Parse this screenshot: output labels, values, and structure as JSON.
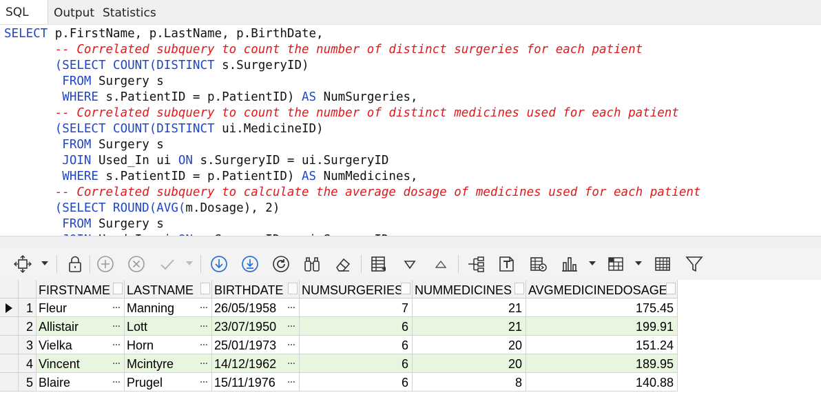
{
  "tabs": [
    {
      "label": "SQL",
      "active": true
    },
    {
      "label": "Output",
      "active": false
    },
    {
      "label": "Statistics",
      "active": false
    }
  ],
  "editor": {
    "language": "SQL",
    "lines": [
      [
        {
          "t": "kw",
          "v": "SELECT"
        },
        {
          "t": "tx",
          "v": " p.FirstName, p.LastName, p.BirthDate,"
        }
      ],
      [
        {
          "t": "cm",
          "v": "       -- Correlated subquery to count the number of distinct surgeries for each patient"
        }
      ],
      [
        {
          "t": "kw",
          "v": "       (SELECT COUNT(DISTINCT"
        },
        {
          "t": "tx",
          "v": " s.SurgeryID)"
        }
      ],
      [
        {
          "t": "kw",
          "v": "        FROM"
        },
        {
          "t": "tx",
          "v": " Surgery s"
        }
      ],
      [
        {
          "t": "kw",
          "v": "        WHERE"
        },
        {
          "t": "tx",
          "v": " s.PatientID = p.PatientID) "
        },
        {
          "t": "kw",
          "v": "AS"
        },
        {
          "t": "tx",
          "v": " NumSurgeries,"
        }
      ],
      [
        {
          "t": "cm",
          "v": "       -- Correlated subquery to count the number of distinct medicines used for each patient"
        }
      ],
      [
        {
          "t": "kw",
          "v": "       (SELECT COUNT(DISTINCT"
        },
        {
          "t": "tx",
          "v": " ui.MedicineID)"
        }
      ],
      [
        {
          "t": "kw",
          "v": "        FROM"
        },
        {
          "t": "tx",
          "v": " Surgery s"
        }
      ],
      [
        {
          "t": "kw",
          "v": "        JOIN"
        },
        {
          "t": "tx",
          "v": " Used_In ui "
        },
        {
          "t": "kw",
          "v": "ON"
        },
        {
          "t": "tx",
          "v": " s.SurgeryID = ui.SurgeryID"
        }
      ],
      [
        {
          "t": "kw",
          "v": "        WHERE"
        },
        {
          "t": "tx",
          "v": " s.PatientID = p.PatientID) "
        },
        {
          "t": "kw",
          "v": "AS"
        },
        {
          "t": "tx",
          "v": " NumMedicines,"
        }
      ],
      [
        {
          "t": "cm",
          "v": "       -- Correlated subquery to calculate the average dosage of medicines used for each patient"
        }
      ],
      [
        {
          "t": "kw",
          "v": "       (SELECT ROUND(AVG("
        },
        {
          "t": "tx",
          "v": "m.Dosage), 2)"
        }
      ],
      [
        {
          "t": "kw",
          "v": "        FROM"
        },
        {
          "t": "tx",
          "v": " Surgery s"
        }
      ],
      [
        {
          "t": "kw",
          "v": "        JOIN"
        },
        {
          "t": "tx",
          "v": " Used_In ui "
        },
        {
          "t": "kw",
          "v": "ON"
        },
        {
          "t": "tx",
          "v": " s.SurgeryID = ui.SurgeryID"
        }
      ]
    ]
  },
  "toolbar": {
    "buttons": [
      {
        "icon": "navigator-icon",
        "enabled": true,
        "dropdown": true
      },
      {
        "icon": "lock-icon",
        "enabled": true
      },
      {
        "icon": "add-record-icon",
        "enabled": false
      },
      {
        "icon": "delete-record-icon",
        "enabled": false
      },
      {
        "icon": "post-edit-icon",
        "enabled": false,
        "dropdown": true
      },
      {
        "icon": "fetch-next-icon",
        "enabled": true
      },
      {
        "icon": "fetch-last-icon",
        "enabled": true
      },
      {
        "icon": "refresh-icon",
        "enabled": true
      },
      {
        "icon": "search-records-icon",
        "enabled": true
      },
      {
        "icon": "clear-icon",
        "enabled": true
      },
      {
        "icon": "single-record-view-icon",
        "enabled": true
      },
      {
        "icon": "sort-descending-icon",
        "enabled": true
      },
      {
        "icon": "sort-ascending-icon",
        "enabled": true
      },
      {
        "icon": "tree-view-icon",
        "enabled": true
      },
      {
        "icon": "export-text-icon",
        "enabled": true
      },
      {
        "icon": "export-grid-icon",
        "enabled": true
      },
      {
        "icon": "chart-icon",
        "enabled": true,
        "dropdown": true
      },
      {
        "icon": "pivot-icon",
        "enabled": true,
        "dropdown": true
      },
      {
        "icon": "grid-icon",
        "enabled": true
      },
      {
        "icon": "filter-icon",
        "enabled": true
      }
    ]
  },
  "grid": {
    "columns": [
      "FIRSTNAME",
      "LASTNAME",
      "BIRTHDATE",
      "NUMSURGERIES",
      "NUMMEDICINES",
      "AVGMEDICINEDOSAGE"
    ],
    "ellipsis": "…",
    "rows": [
      {
        "n": "1",
        "values": [
          "Fleur",
          "Manning",
          "26/05/1958",
          "7",
          "21",
          "175.45"
        ],
        "current": true
      },
      {
        "n": "2",
        "values": [
          "Allistair",
          "Lott",
          "23/07/1950",
          "6",
          "21",
          "199.91"
        ]
      },
      {
        "n": "3",
        "values": [
          "Vielka",
          "Horn",
          "25/01/1973",
          "6",
          "20",
          "151.24"
        ]
      },
      {
        "n": "4",
        "values": [
          "Vincent",
          "Mcintyre",
          "14/12/1962",
          "6",
          "20",
          "189.95"
        ]
      },
      {
        "n": "5",
        "values": [
          "Blaire",
          "Prugel",
          "15/11/1976",
          "6",
          "8",
          "140.88"
        ]
      }
    ]
  },
  "colors": {
    "keyword": "#1f46c6",
    "comment": "#e0191c",
    "alt_row": "#e8f6e0",
    "icon_blue": "#2a6fd6"
  }
}
